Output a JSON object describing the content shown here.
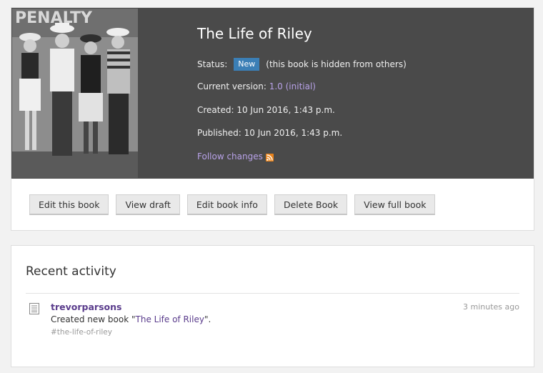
{
  "book": {
    "cover_text": "PENALTY",
    "title": "The Life of Riley",
    "status_label": "Status:",
    "status_badge": "New",
    "status_note": "(this book is hidden from others)",
    "version_label": "Current version:",
    "version_value": "1.0 (initial)",
    "created": "Created: 10 Jun 2016, 1:43 p.m.",
    "published": "Published: 10 Jun 2016, 1:43 p.m.",
    "follow_label": "Follow changes",
    "colors": {
      "header_bg": "#4a4a4a",
      "badge": "#3b7fb6",
      "link": "#b8a2e8",
      "rss": "#e8831c"
    }
  },
  "toolbar": {
    "edit_book": "Edit this book",
    "view_draft": "View draft",
    "edit_info": "Edit book info",
    "delete_book": "Delete Book",
    "view_full": "View full book"
  },
  "activity": {
    "title": "Recent activity",
    "items": [
      {
        "icon": "document-icon",
        "user": "trevorparsons",
        "time": "3 minutes ago",
        "text_before": "Created new book \"",
        "book_link": "The Life of Riley",
        "text_after": "\".",
        "tag": "#the-life-of-riley"
      }
    ]
  }
}
